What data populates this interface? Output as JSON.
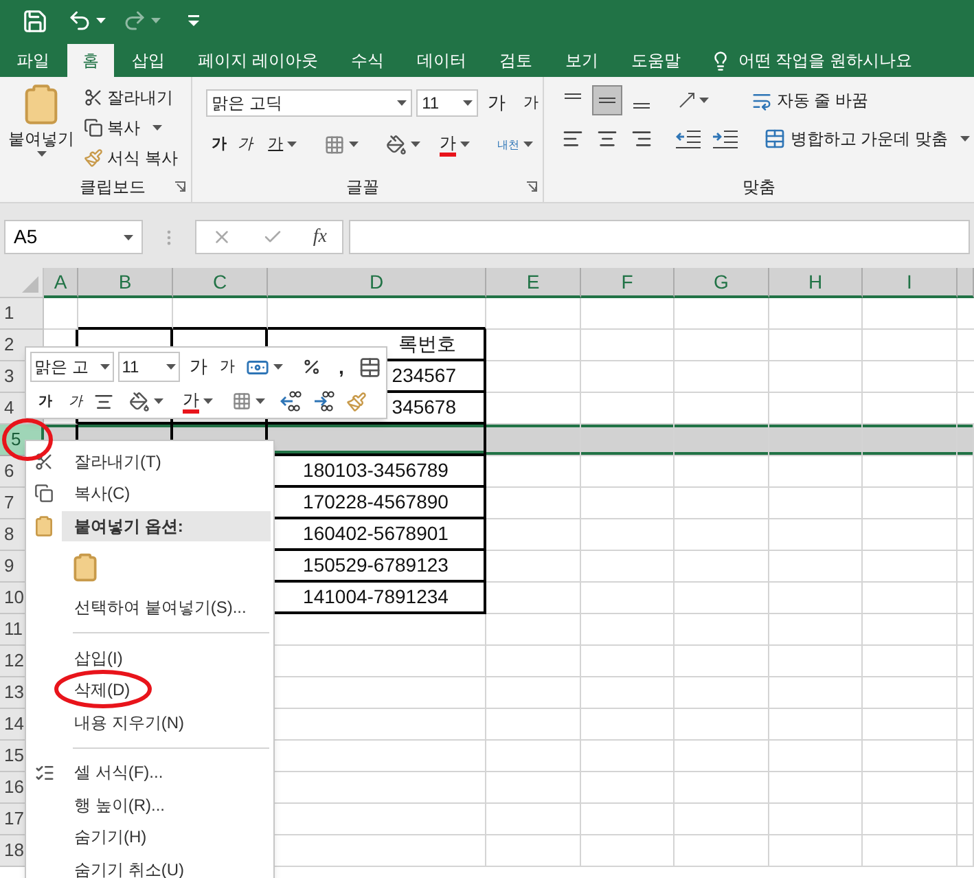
{
  "ribbon_tabs": [
    {
      "label": "파일",
      "selected": false
    },
    {
      "label": "홈",
      "selected": true
    },
    {
      "label": "삽입",
      "selected": false
    },
    {
      "label": "페이지 레이아웃",
      "selected": false
    },
    {
      "label": "수식",
      "selected": false
    },
    {
      "label": "데이터",
      "selected": false
    },
    {
      "label": "검토",
      "selected": false
    },
    {
      "label": "보기",
      "selected": false
    },
    {
      "label": "도움말",
      "selected": false
    }
  ],
  "tell_me": "어떤 작업을 원하시나요",
  "clipboard": {
    "paste": "붙여넣기",
    "cut": "잘라내기",
    "copy": "복사",
    "format_painter": "서식 복사",
    "label": "클립보드"
  },
  "font": {
    "font_name": "맑은 고딕",
    "font_size": "11",
    "grow": "가",
    "shrink": "가",
    "bold": "가",
    "italic": "가",
    "underline": "가",
    "font_color": "가",
    "phonetic": "내천",
    "label": "글꼴"
  },
  "alignment": {
    "vertical": [
      {
        "kind": "top",
        "selected": false
      },
      {
        "kind": "middle",
        "selected": true
      },
      {
        "kind": "bottom",
        "selected": false
      }
    ],
    "wrap_text": "자동 줄 바꿈",
    "merge": "병합하고 가운데 맞춤",
    "label": "맞춤"
  },
  "formula_bar": {
    "name_box": "A5",
    "fx": "fx"
  },
  "sheet": {
    "columns": [
      "A",
      "B",
      "C",
      "D",
      "E",
      "F",
      "G",
      "H",
      "I"
    ],
    "rows": [
      {
        "header": "1",
        "selected": false,
        "circled": false
      },
      {
        "header": "2",
        "selected": false,
        "circled": false,
        "column_d": "록번호"
      },
      {
        "header": "3",
        "selected": false,
        "circled": false,
        "column_d": "234567"
      },
      {
        "header": "4",
        "selected": false,
        "circled": false,
        "column_d": "345678"
      },
      {
        "header": "5",
        "selected": true,
        "circled": true
      },
      {
        "header": "6",
        "selected": false,
        "circled": false,
        "column_d": "180103-3456789"
      },
      {
        "header": "7",
        "selected": false,
        "circled": false,
        "column_d": "170228-4567890"
      },
      {
        "header": "8",
        "selected": false,
        "circled": false,
        "column_d": "160402-5678901"
      },
      {
        "header": "9",
        "selected": false,
        "circled": false,
        "column_d": "150529-6789123"
      },
      {
        "header": "10",
        "selected": false,
        "circled": false,
        "column_d": "141004-7891234"
      },
      {
        "header": "11",
        "selected": false,
        "circled": false
      },
      {
        "header": "12",
        "selected": false,
        "circled": false
      },
      {
        "header": "13",
        "selected": false,
        "circled": false
      },
      {
        "header": "14",
        "selected": false,
        "circled": false
      },
      {
        "header": "15",
        "selected": false,
        "circled": false
      },
      {
        "header": "16",
        "selected": false,
        "circled": false
      },
      {
        "header": "17",
        "selected": false,
        "circled": false
      },
      {
        "header": "18",
        "selected": false,
        "circled": false
      }
    ]
  },
  "mini_toolbar": {
    "font_name": "맑은 고",
    "font_size": "11",
    "grow": "가",
    "shrink": "가",
    "comma": ",",
    "bold": "가",
    "italic": "가",
    "font_color": "가"
  },
  "context_menu": {
    "items": [
      {
        "kind": "cut",
        "label": "잘라내기(T)",
        "circled": false
      },
      {
        "kind": "copy",
        "label": "복사(C)",
        "circled": false
      },
      {
        "kind": "heading",
        "label": "붙여넣기 옵션:"
      },
      {
        "kind": "paste_option"
      },
      {
        "kind": "item",
        "label": "선택하여 붙여넣기(S)...",
        "circled": false
      },
      {
        "kind": "separator"
      },
      {
        "kind": "item",
        "label": "삽입(I)",
        "circled": false
      },
      {
        "kind": "item",
        "label": "삭제(D)",
        "circled": true
      },
      {
        "kind": "item",
        "label": "내용 지우기(N)",
        "circled": false
      },
      {
        "kind": "separator"
      },
      {
        "kind": "format",
        "label": "셀 서식(F)...",
        "circled": false
      },
      {
        "kind": "item",
        "label": "행 높이(R)...",
        "circled": false
      },
      {
        "kind": "item",
        "label": "숨기기(H)",
        "circled": false
      },
      {
        "kind": "item",
        "label": "숨기기 취소(U)",
        "circled": false
      }
    ]
  }
}
